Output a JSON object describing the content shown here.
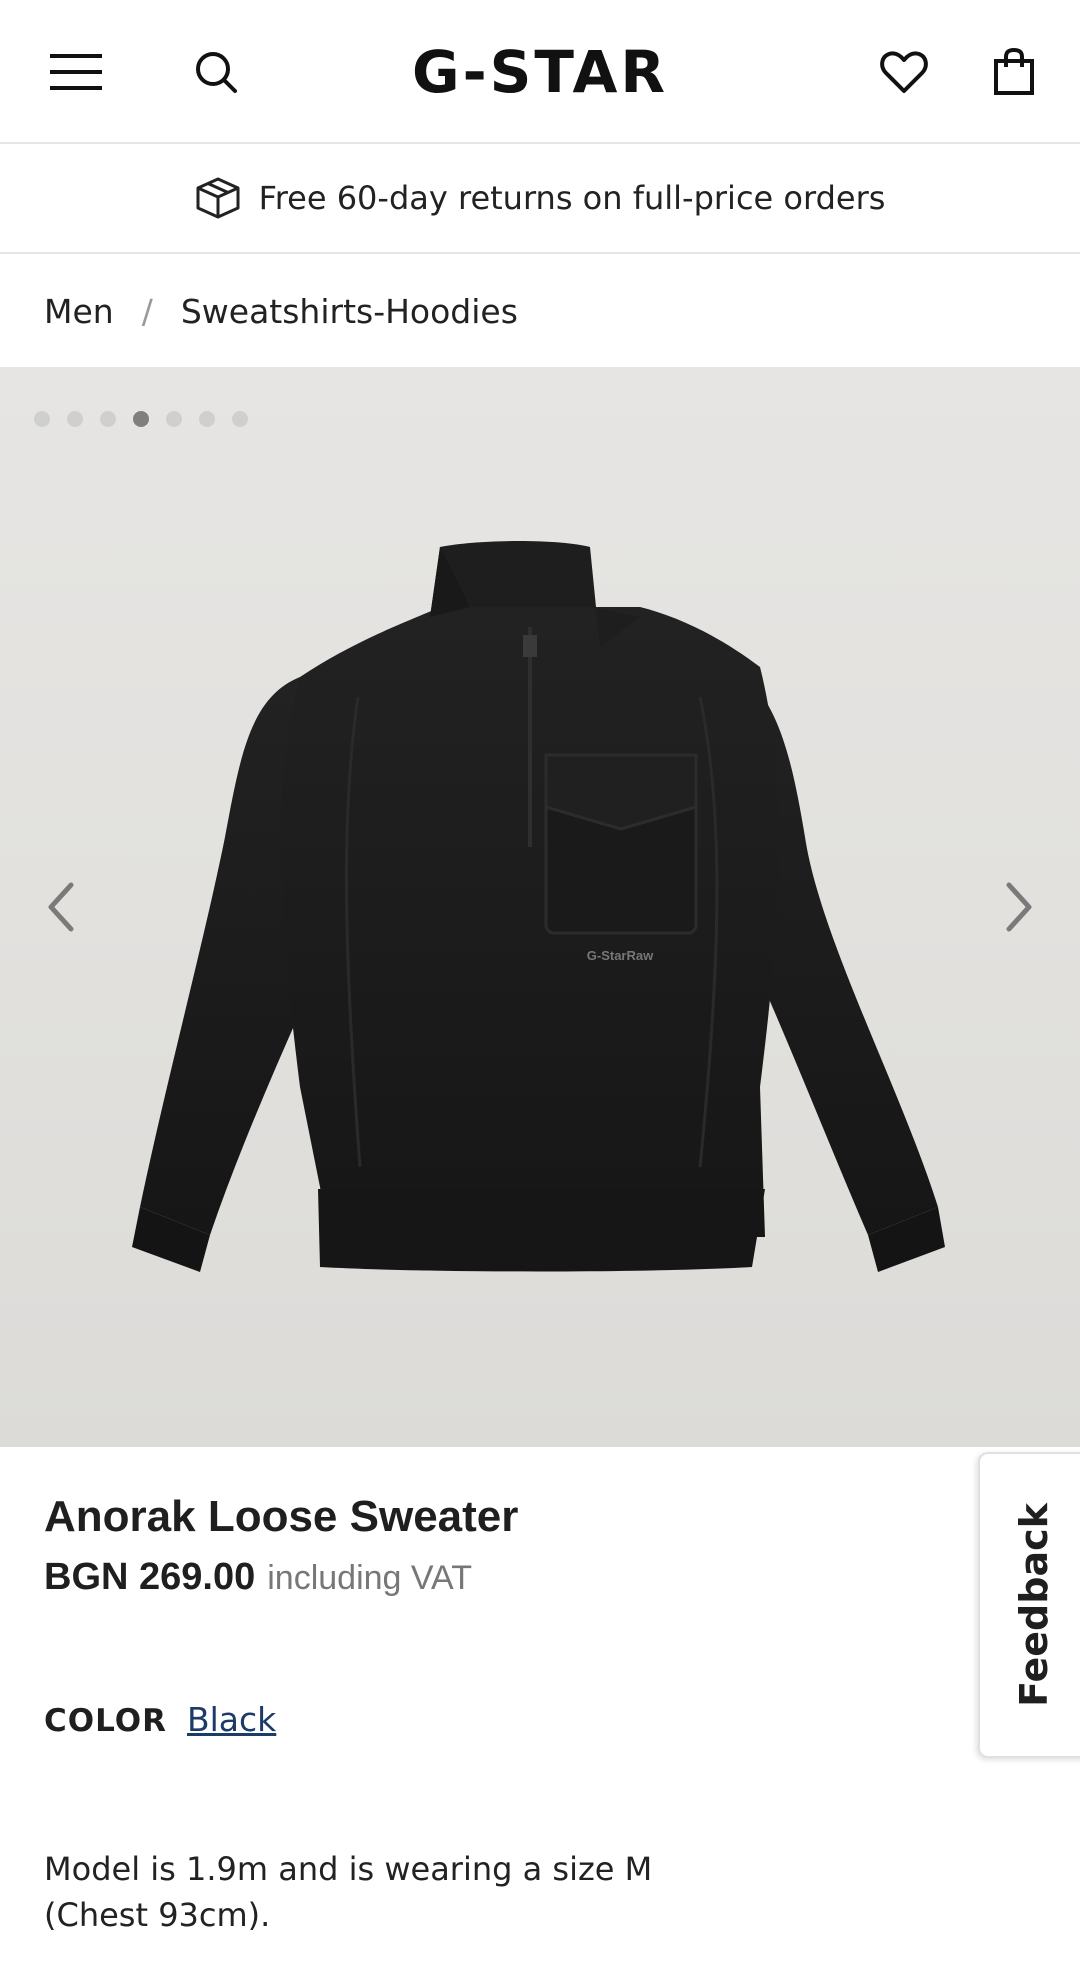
{
  "header": {
    "logo": "G-STAR",
    "icons": [
      "menu-icon",
      "search-icon",
      "heart-icon",
      "shopping-bag-icon"
    ]
  },
  "promo": {
    "text": "Free 60-day returns on full-price orders",
    "icon": "box-icon"
  },
  "breadcrumb": {
    "items": [
      "Men",
      "Sweatshirts-Hoodies"
    ],
    "separator": "/"
  },
  "gallery": {
    "image_count": 7,
    "active_index": 3,
    "product_brand_mark": "G-StarRaw"
  },
  "product": {
    "name": "Anorak Loose Sweater",
    "price": "BGN 269.00",
    "vat_note": "including VAT",
    "color_label": "COLOR",
    "color_value": "Black",
    "model_note_line1": "Model is 1.9m and is wearing a size M",
    "model_note_line2": "(Chest 93cm)."
  },
  "feedback": {
    "label": "Feedback"
  },
  "colors": {
    "link": "#1c3b66",
    "text": "#1f1f1f",
    "muted": "#777777",
    "garment": "#1b1b1b"
  }
}
